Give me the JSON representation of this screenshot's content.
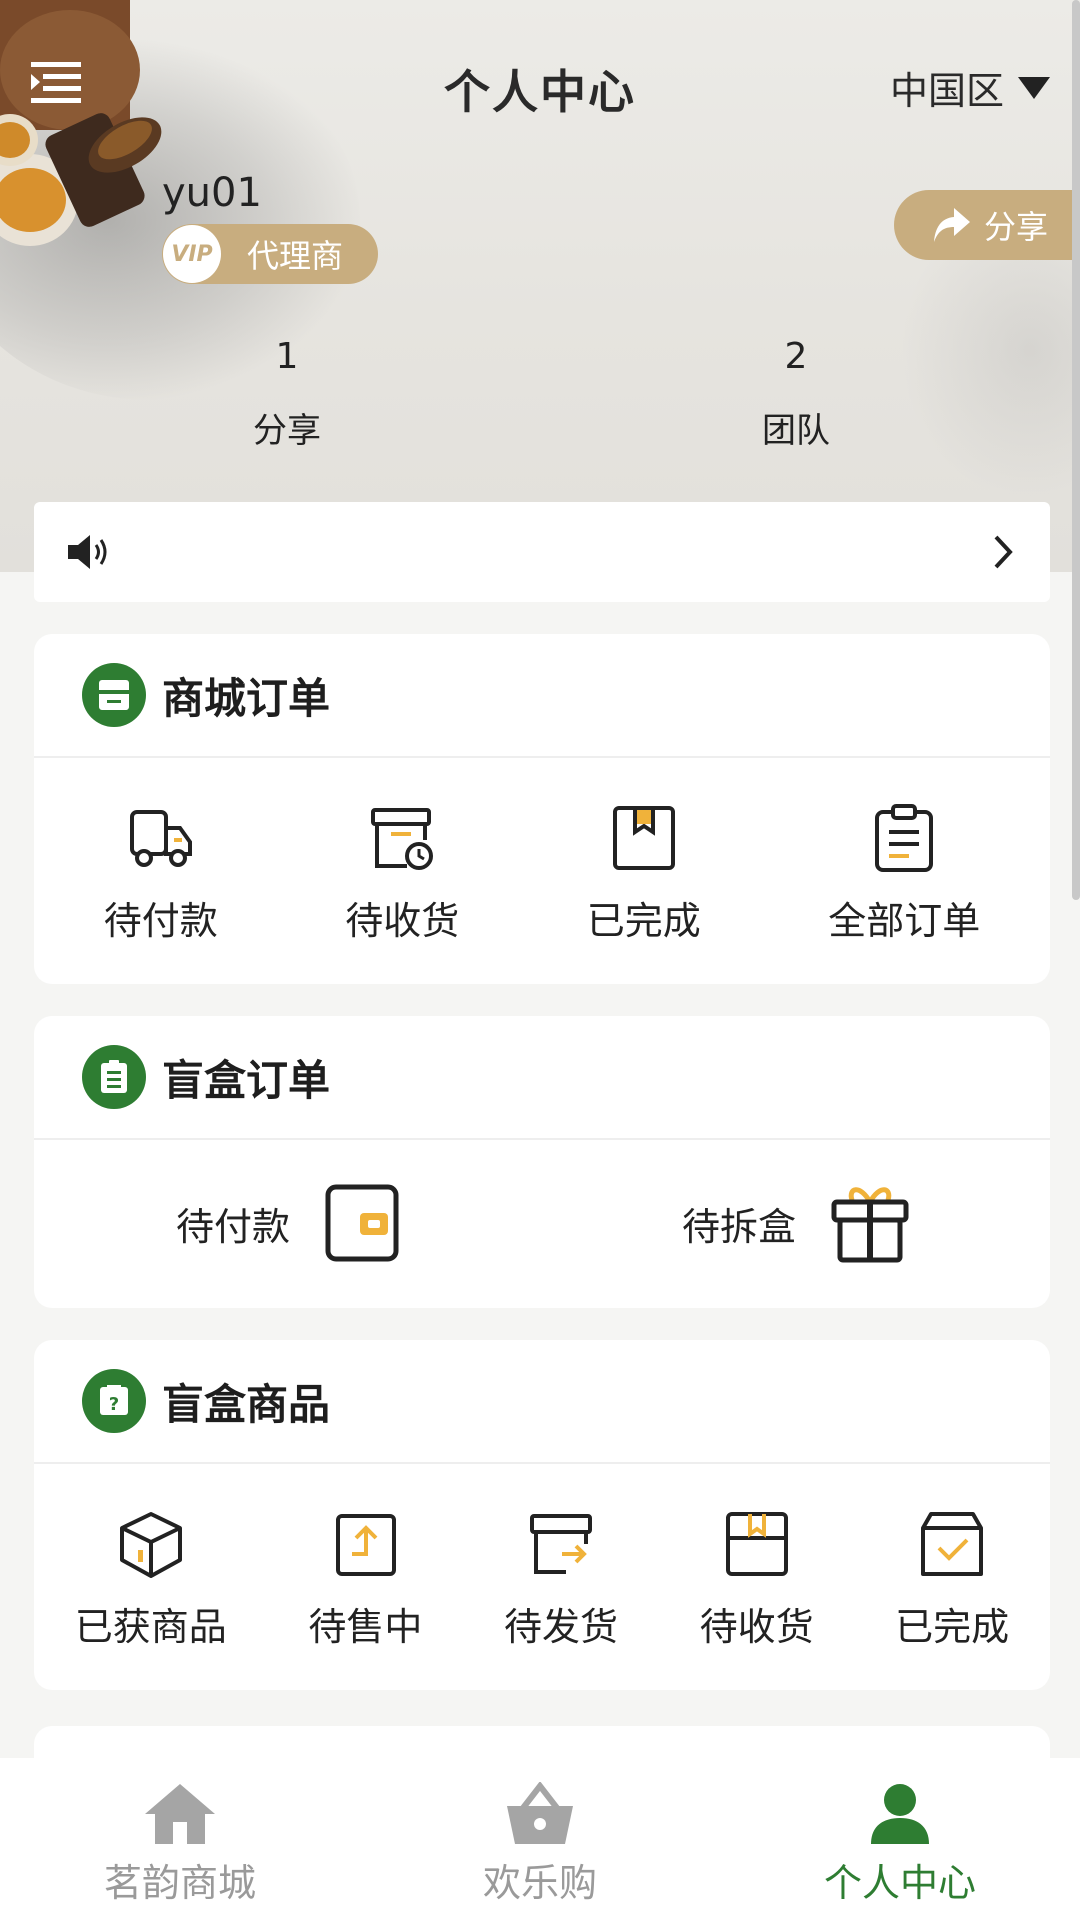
{
  "header": {
    "title": "个人中心",
    "region": "中国区"
  },
  "profile": {
    "username": "yu01",
    "vip_badge": "VIP",
    "level": "代理商",
    "share_label": "分享",
    "stats": [
      {
        "value": "1",
        "label": "分享"
      },
      {
        "value": "2",
        "label": "团队"
      }
    ]
  },
  "mall_orders": {
    "title": "商城订单",
    "items": [
      {
        "label": "待付款",
        "icon": "truck-icon"
      },
      {
        "label": "待收货",
        "icon": "box-clock-icon"
      },
      {
        "label": "已完成",
        "icon": "package-icon"
      },
      {
        "label": "全部订单",
        "icon": "clipboard-icon"
      }
    ]
  },
  "blindbox_orders": {
    "title": "盲盒订单",
    "items": [
      {
        "label": "待付款",
        "icon": "wallet-icon"
      },
      {
        "label": "待拆盒",
        "icon": "gift-icon"
      }
    ]
  },
  "blindbox_goods": {
    "title": "盲盒商品",
    "items": [
      {
        "label": "已获商品",
        "icon": "cube-icon"
      },
      {
        "label": "待售中",
        "icon": "upload-box-icon"
      },
      {
        "label": "待发货",
        "icon": "ship-box-icon"
      },
      {
        "label": "待收货",
        "icon": "receive-box-icon"
      },
      {
        "label": "已完成",
        "icon": "done-box-icon"
      }
    ]
  },
  "bottom_nav": [
    {
      "label": "茗韵商城",
      "icon": "home-icon",
      "active": false
    },
    {
      "label": "欢乐购",
      "icon": "basket-icon",
      "active": false
    },
    {
      "label": "个人中心",
      "icon": "person-icon",
      "active": true
    }
  ],
  "colors": {
    "accent_green": "#2e7d32",
    "gold": "#c8ad7f",
    "icon_orange": "#f0b23a"
  }
}
